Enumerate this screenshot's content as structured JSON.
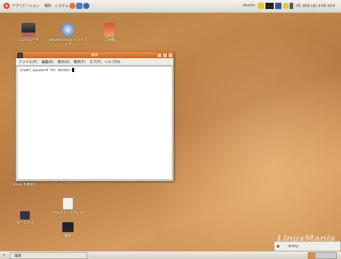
{
  "top_panel": {
    "applications": "アプリケーション",
    "places": "場所",
    "system": "システム",
    "user": "ubuntu",
    "clock": "7月 16日 (水) 9:56 16:0"
  },
  "desktop_icons": [
    {
      "label": "コンピュータ"
    },
    {
      "label": "Ubuntu Linux ハンドブック"
    },
    {
      "label": "ごみ箱"
    },
    {
      "label": "Linux を使おう"
    },
    {
      "label": "ワードプロセッサ"
    },
    {
      "label": "テキスト・エディタ"
    },
    {
      "label": "ターミナル"
    },
    {
      "label": "端末"
    }
  ],
  "terminal": {
    "title": "端末",
    "menu": [
      "ファイル(F)",
      "編集(E)",
      "表示(V)",
      "端末(T)",
      "タブ(T)",
      "ヘルプ(H)"
    ],
    "prompt": "[sudo] password for ubuntu:"
  },
  "bottom_panel": {
    "task": "端末",
    "tray_text": "Archy"
  },
  "watermark": "LinuxMania",
  "colors": {
    "title_bar": "#d9772e",
    "desktop": "#c58a4c"
  }
}
